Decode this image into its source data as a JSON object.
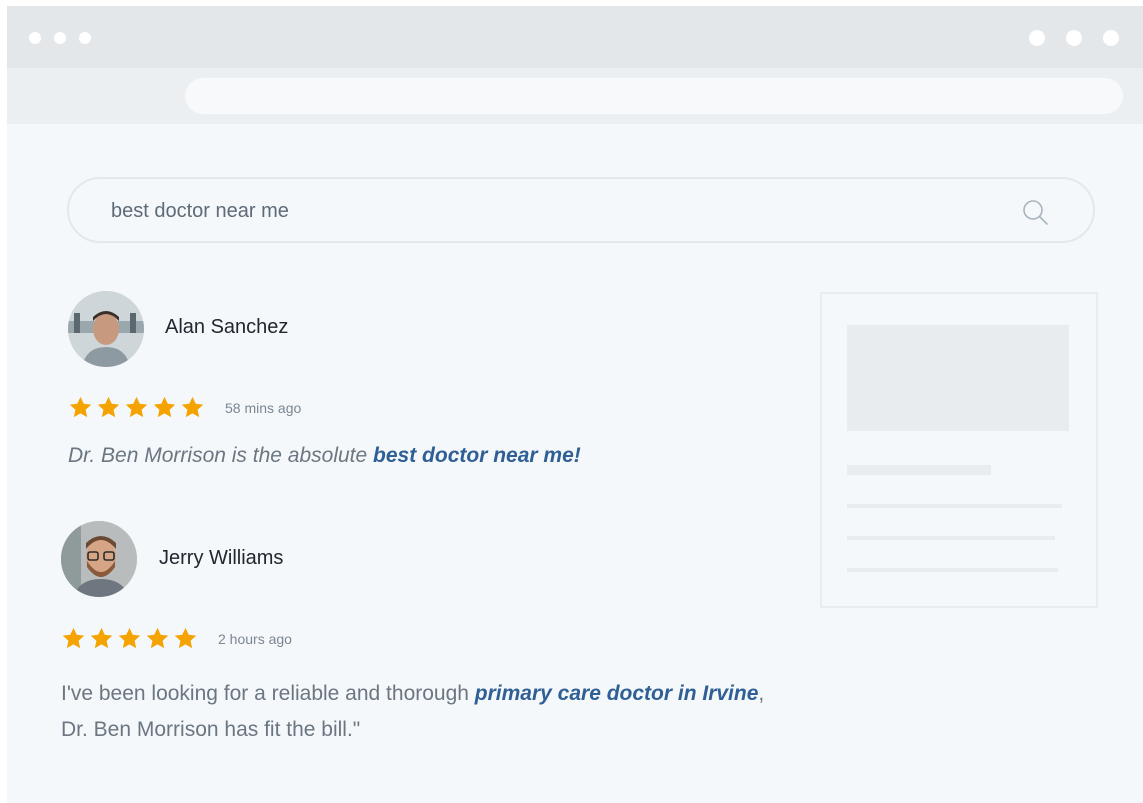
{
  "search": {
    "query": "best doctor near me"
  },
  "reviews": [
    {
      "name": "Alan Sanchez",
      "stars": 5,
      "time": "58 mins ago",
      "text_before": "Dr. Ben Morrison is the absolute ",
      "text_link": "best doctor near me!",
      "text_after": ""
    },
    {
      "name": "Jerry Williams",
      "stars": 5,
      "time": "2 hours ago",
      "text_before": "I've been looking for a reliable and thorough ",
      "text_link": "primary care doctor in Irvine",
      "text_after": ", Dr. Ben Morrison has fit the bill.\""
    }
  ],
  "colors": {
    "star": "#f5a300",
    "link": "#2f5f94",
    "titlebar": "#e3e7ea",
    "page_bg": "#f4f8fb"
  }
}
